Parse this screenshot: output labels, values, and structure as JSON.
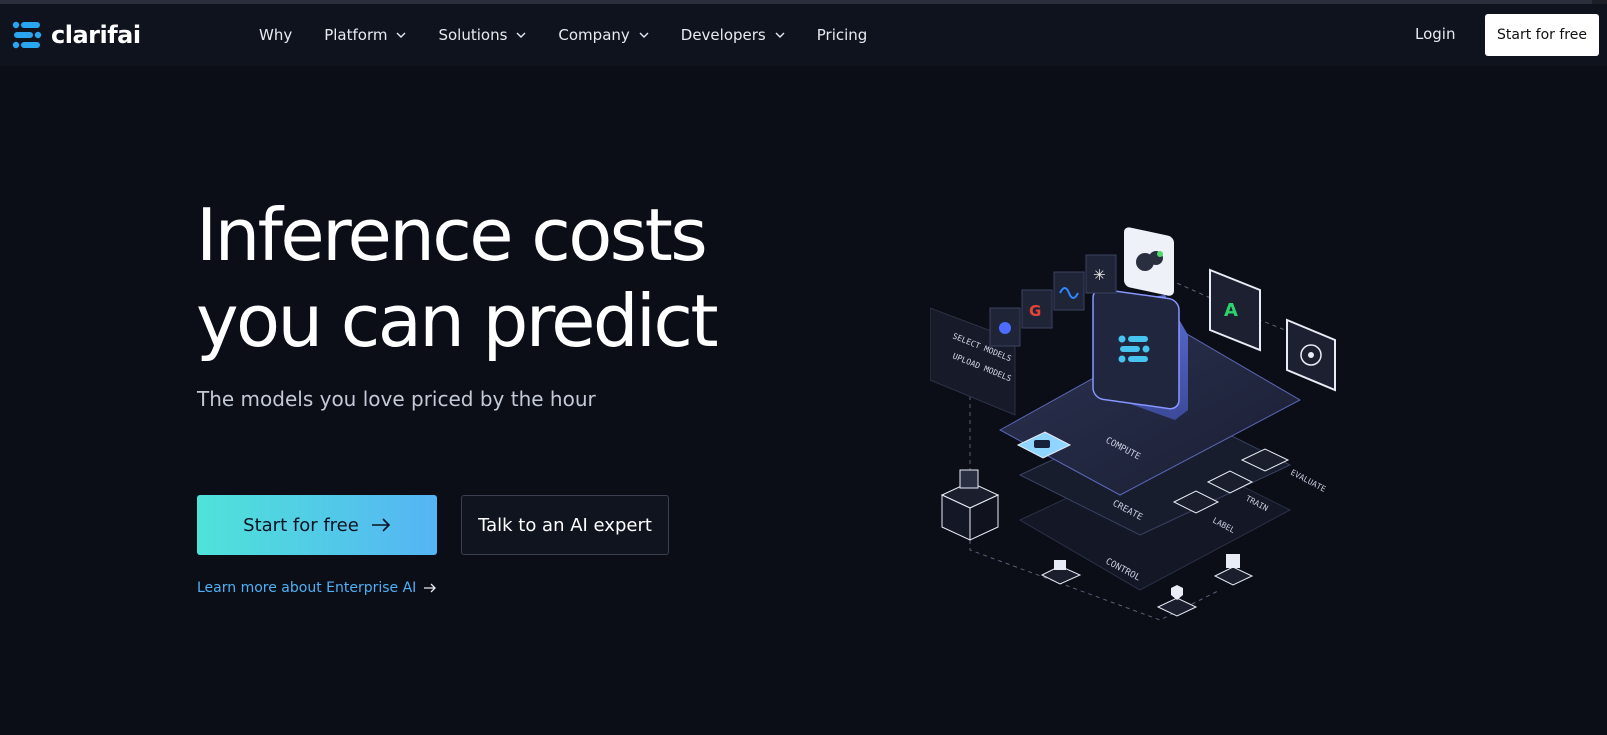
{
  "brand": {
    "name": "clarifai",
    "accent": "#2aa5f0"
  },
  "nav": {
    "items": [
      {
        "label": "Why",
        "dropdown": false
      },
      {
        "label": "Platform",
        "dropdown": true
      },
      {
        "label": "Solutions",
        "dropdown": true
      },
      {
        "label": "Company",
        "dropdown": true
      },
      {
        "label": "Developers",
        "dropdown": true
      },
      {
        "label": "Pricing",
        "dropdown": false
      }
    ],
    "login": "Login",
    "cta": "Start for free"
  },
  "hero": {
    "title_line1": "Inference costs",
    "title_line2": "you can predict",
    "subtitle": "The models you love priced by the hour",
    "primary_cta": "Start for free",
    "secondary_cta": "Talk to an AI expert",
    "learn_more": "Learn more about Enterprise AI"
  },
  "illustration": {
    "panel_lines": [
      "SELECT MODELS",
      "UPLOAD MODELS"
    ],
    "layers": [
      "COMPUTE",
      "CREATE",
      "CONTROL"
    ],
    "nodes": [
      "EVALUATE",
      "TRAIN",
      "LABEL"
    ]
  },
  "colors": {
    "background": "#0b0e17",
    "header": "#0f131e",
    "primary_gradient_start": "#4fe3d9",
    "primary_gradient_end": "#55b4f4",
    "link": "#4fb0f5"
  }
}
